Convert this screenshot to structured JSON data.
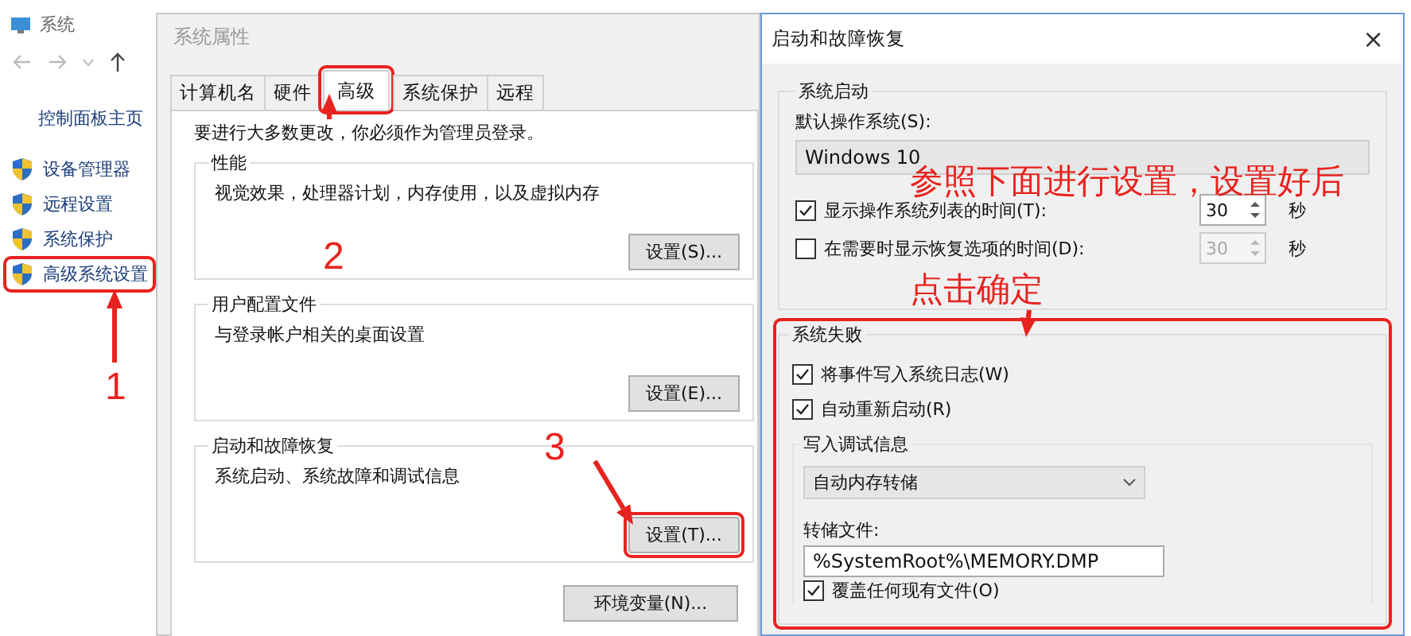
{
  "system_window": {
    "title": "系统",
    "sidebar": {
      "home": "控制面板主页",
      "items": [
        {
          "label": "设备管理器",
          "highlighted": false
        },
        {
          "label": "远程设置",
          "highlighted": false
        },
        {
          "label": "系统保护",
          "highlighted": false
        },
        {
          "label": "高级系统设置",
          "highlighted": true
        }
      ]
    }
  },
  "properties_dialog": {
    "title": "系统属性",
    "tabs": [
      {
        "label": "计算机名",
        "selected": false,
        "highlighted": false
      },
      {
        "label": "硬件",
        "selected": false,
        "highlighted": false
      },
      {
        "label": "高级",
        "selected": true,
        "highlighted": true
      },
      {
        "label": "系统保护",
        "selected": false,
        "highlighted": false
      },
      {
        "label": "远程",
        "selected": false,
        "highlighted": false
      }
    ],
    "notice": "要进行大多数更改，你必须作为管理员登录。",
    "groups": [
      {
        "title": "性能",
        "description": "视觉效果，处理器计划，内存使用，以及虚拟内存",
        "button": {
          "label": "设置(S)...",
          "highlighted": false
        }
      },
      {
        "title": "用户配置文件",
        "description": "与登录帐户相关的桌面设置",
        "button": {
          "label": "设置(E)...",
          "highlighted": false
        }
      },
      {
        "title": "启动和故障恢复",
        "description": "系统启动、系统故障和调试信息",
        "button": {
          "label": "设置(T)...",
          "highlighted": true
        }
      }
    ],
    "footer_button": "环境变量(N)..."
  },
  "startup_dialog": {
    "title": "启动和故障恢复",
    "close": "×",
    "startup_group": {
      "title": "系统启动",
      "default_os_label": "默认操作系统(S):",
      "default_os": "Windows 10",
      "timers": [
        {
          "label": "显示操作系统列表的时间(T):",
          "checked": true,
          "value": "30",
          "unit": "秒",
          "disabled": false
        },
        {
          "label": "在需要时显示恢复选项的时间(D):",
          "checked": false,
          "value": "30",
          "unit": "秒",
          "disabled": true
        }
      ]
    },
    "failure_group": {
      "title": "系统失败",
      "highlighted": true,
      "options": [
        {
          "label": "将事件写入系统日志(W)",
          "checked": true
        },
        {
          "label": "自动重新启动(R)",
          "checked": true
        }
      ],
      "debug": {
        "title": "写入调试信息",
        "dump_type": "自动内存转储",
        "dump_file_label": "转储文件:",
        "dump_file": "%SystemRoot%\\MEMORY.DMP",
        "overwrite": {
          "label": "覆盖任何现有文件(O)",
          "checked": true
        }
      }
    }
  },
  "annotations": {
    "steps": [
      "1",
      "2",
      "3"
    ],
    "note": [
      "参照下面进行设置，设置好后",
      "点击确定"
    ]
  }
}
